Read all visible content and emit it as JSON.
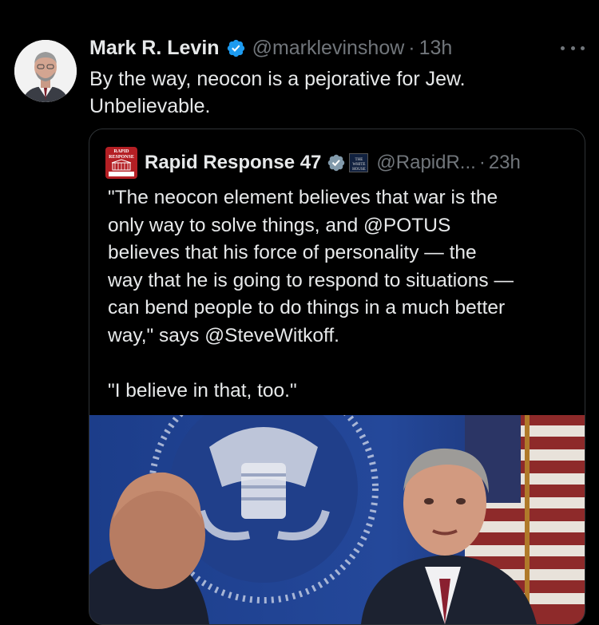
{
  "tweet": {
    "author_name": "Mark R. Levin",
    "handle": "@marklevinshow",
    "separator": "·",
    "time": "13h",
    "text_lines": [
      "By the way, neocon is a pejorative for Jew.",
      "Unbelievable."
    ]
  },
  "quoted_tweet": {
    "author_name": "Rapid Response 47",
    "avatar_text": [
      "RAPID",
      "RESPONSE"
    ],
    "affiliation_badge_text": [
      "THE",
      "WHITE",
      "HOUSE"
    ],
    "handle": "@RapidR...",
    "separator": "·",
    "time": "23h",
    "text_lines": [
      "\"The neocon element believes that war is the",
      "only way to solve things, and @POTUS",
      "believes that his force of personality — the",
      "way that he is going to respond to situations —",
      "can bend people to do things in a much better",
      "way,\" says @SteveWitkoff."
    ],
    "text_line_after_gap": "\"I believe in that, too.\""
  },
  "icons": {
    "verified": "verified-badge-icon",
    "more": "more-options-icon"
  },
  "colors": {
    "background": "#000000",
    "text_primary": "#e7e9ea",
    "text_secondary": "#71767b",
    "verified_blue": "#1d9bf0",
    "verified_gray": "#829aab",
    "card_border": "#2f3336"
  }
}
